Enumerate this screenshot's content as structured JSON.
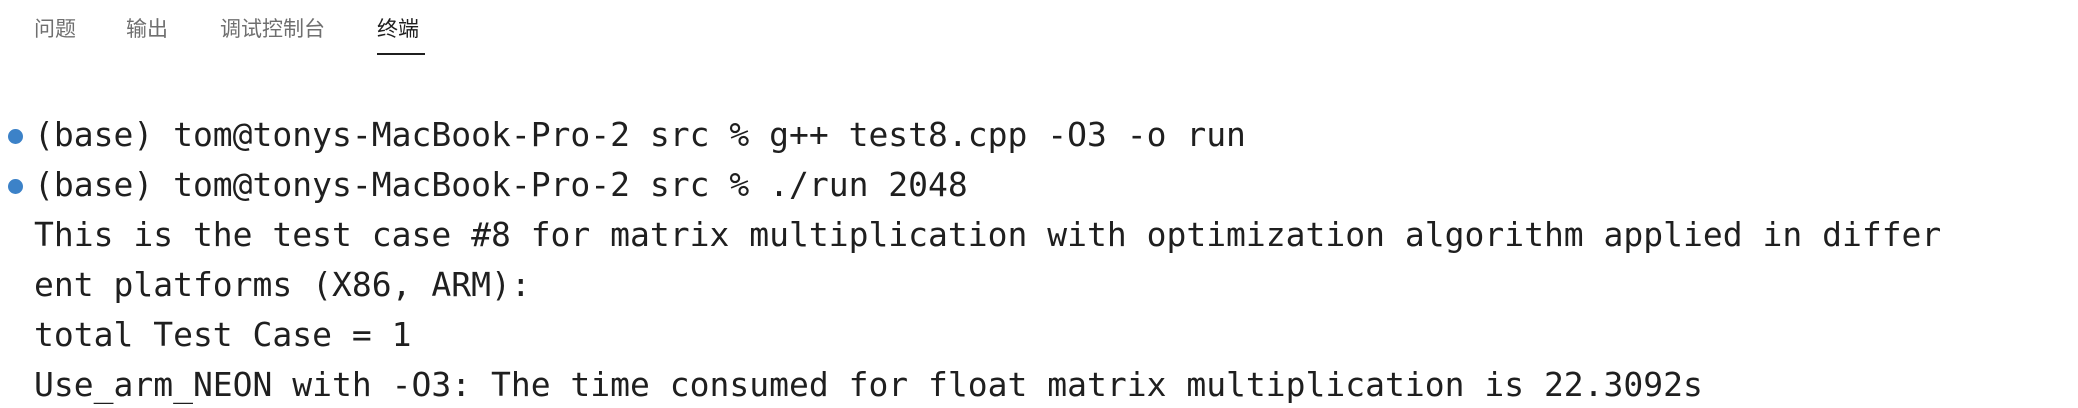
{
  "panel": {
    "tabs": [
      {
        "label": "问题",
        "active": false
      },
      {
        "label": "输出",
        "active": false
      },
      {
        "label": "调试控制台",
        "active": false
      },
      {
        "label": "终端",
        "active": true
      }
    ]
  },
  "terminal": {
    "lines": [
      {
        "text": "(base) tom@tonys-MacBook-Pro-2 src % g++ test8.cpp -O3 -o run",
        "marker": "command-dot"
      },
      {
        "text": "(base) tom@tonys-MacBook-Pro-2 src % ./run 2048",
        "marker": "command-dot"
      },
      {
        "text": "This is the test case #8 for matrix multiplication with optimization algorithm applied in differ",
        "marker": ""
      },
      {
        "text": "ent platforms (X86, ARM):",
        "marker": ""
      },
      {
        "text": "total Test Case = 1",
        "marker": ""
      },
      {
        "text": "Use_arm_NEON with -O3: The time consumed for float matrix multiplication is 22.3092s",
        "marker": ""
      }
    ]
  },
  "colors": {
    "command_dot": "#3c82c8",
    "text": "#1f1f1f",
    "tab_inactive": "#6f6f6f"
  }
}
